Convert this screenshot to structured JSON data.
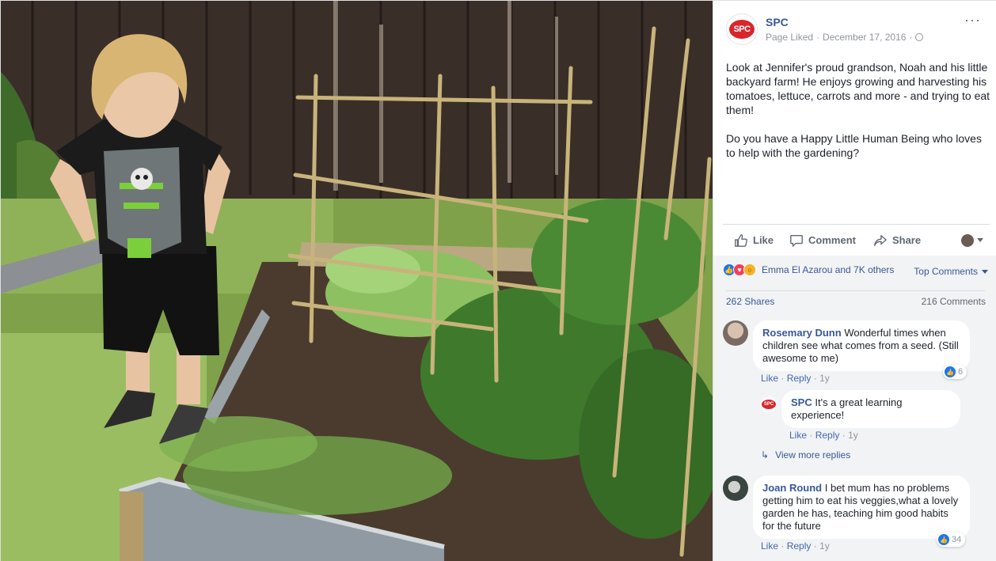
{
  "post": {
    "page_name": "SPC",
    "logo_text": "SPC",
    "meta_status": "Page Liked",
    "meta_sep": "·",
    "date": "December 17, 2016",
    "more": "···",
    "body_p1": "Look at Jennifer's proud grandson, Noah and his little backyard farm! He enjoys growing and harvesting his tomatoes, lettuce, carrots and more - and trying to eat them!",
    "body_p2": "Do you have a Happy Little Human Being who loves to help with the gardening?"
  },
  "actions": {
    "like": "Like",
    "comment": "Comment",
    "share": "Share"
  },
  "stats": {
    "reactions_text": "Emma El Azarou and 7K others",
    "sort_label": "Top Comments",
    "shares": "262 Shares",
    "comments": "216 Comments"
  },
  "comments": [
    {
      "author": "Rosemary Dunn",
      "text": "Wonderful times when children see what comes from a seed. (Still awesome to me)",
      "like": "Like",
      "reply": "Reply",
      "time": "1y",
      "reactions": "6"
    },
    {
      "author": "SPC",
      "text": "It's a great learning experience!",
      "like": "Like",
      "reply": "Reply",
      "time": "1y"
    },
    {
      "author": "Joan Round",
      "text": "I bet mum has no problems getting him to eat his veggies,what a lovely garden he has, teaching him good habits for the future",
      "like": "Like",
      "reply": "Reply",
      "time": "1y",
      "reactions": "34"
    }
  ],
  "view_more_replies": "View more replies",
  "colors": {
    "link_blue": "#385898",
    "action_blue": "#4267b2",
    "brand_red": "#d9262b",
    "muted": "#90949c",
    "comment_bg": "#f2f3f5"
  },
  "icons": [
    "like-icon",
    "comment-icon",
    "share-icon",
    "globe-icon",
    "more-icon",
    "reply-arrow-icon"
  ]
}
